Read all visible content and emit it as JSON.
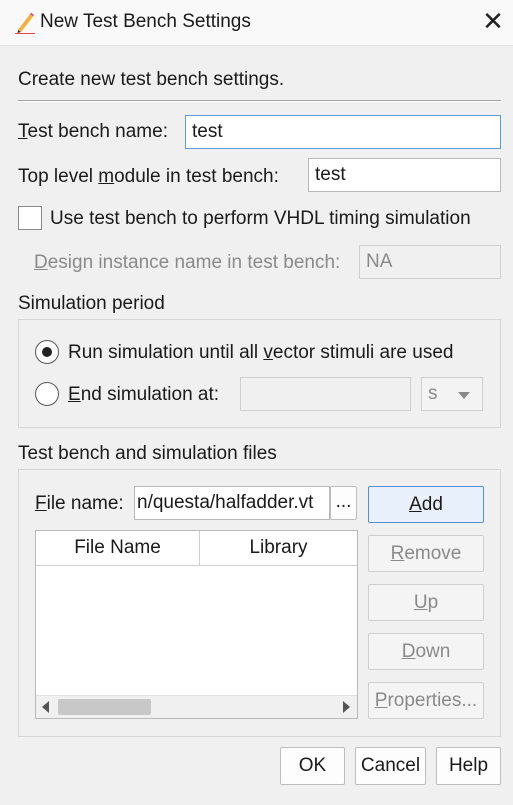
{
  "window": {
    "title": "New Test Bench Settings",
    "close_glyph": "✕"
  },
  "intro": "Create new test bench settings.",
  "test_bench_name": {
    "label_u": "T",
    "label_rest": "est bench name:",
    "value": "test"
  },
  "top_level_module": {
    "label_pre": "Top level ",
    "label_u": "m",
    "label_post": "odule in test bench:",
    "value": "test"
  },
  "vhdl_timing": {
    "label": "Use test bench to perform VHDL timing simulation",
    "checked": false
  },
  "design_instance": {
    "label_u": "D",
    "label_rest": "esign instance name in test bench:",
    "value": "NA"
  },
  "simulation_period": {
    "heading": "Simulation period",
    "run_until": {
      "label_pre": "Run simulation until all ",
      "label_u": "v",
      "label_post": "ector stimuli are used",
      "selected": true
    },
    "end_at": {
      "label_u": "E",
      "label_rest": "nd simulation at:",
      "value": "",
      "unit": "s",
      "selected": false
    }
  },
  "files": {
    "heading": "Test bench and simulation files",
    "file_name_label_u": "F",
    "file_name_label_rest": "ile name:",
    "file_name_value": "n/questa/halfadder.vt",
    "browse_label": "...",
    "columns": [
      "File Name",
      "Library"
    ],
    "rows": [],
    "buttons": {
      "add": {
        "u": "A",
        "rest": "dd"
      },
      "remove": {
        "u": "R",
        "rest": "emove"
      },
      "up": {
        "u": "U",
        "rest": "p"
      },
      "down": {
        "u": "D",
        "rest": "own"
      },
      "properties": {
        "u": "P",
        "rest": "roperties..."
      }
    }
  },
  "footer": {
    "ok": "OK",
    "cancel": "Cancel",
    "help": "Help"
  },
  "colors": {
    "focus_border": "#5b9bd5",
    "default_button": "#e8f1fb"
  },
  "icons": {
    "title": "pencil-icon",
    "close": "close-icon"
  }
}
